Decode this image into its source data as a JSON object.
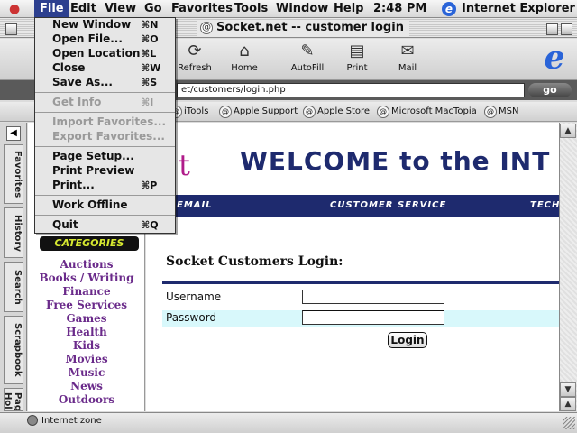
{
  "menubar": {
    "items": [
      "File",
      "Edit",
      "View",
      "Go",
      "Favorites",
      "Tools",
      "Window",
      "Help"
    ],
    "clock": "2:48 PM",
    "app_name": "Internet Explorer"
  },
  "window": {
    "title": "Socket.net -- customer login"
  },
  "toolbar": {
    "buttons": [
      "Refresh",
      "Home",
      "AutoFill",
      "Print",
      "Mail"
    ]
  },
  "address": {
    "value": "et/customers/login.php",
    "go_label": "go"
  },
  "favorites_bar": {
    "links": [
      "iTools",
      "Apple Support",
      "Apple Store",
      "Microsoft MacTopia",
      "MSN"
    ]
  },
  "explorer_tabs": [
    "Favorites",
    "History",
    "Search",
    "Scrapbook",
    "Page Holder"
  ],
  "site": {
    "banner": "WELCOME to the INT",
    "banner_logo_fragment": "t",
    "nav": [
      "EMAIL",
      "CUSTOMER SERVICE",
      "TECH"
    ],
    "categories_logo": "CATEGORIES",
    "categories": [
      "Auctions",
      "Books / Writing",
      "Finance",
      "Free Services",
      "Games",
      "Health",
      "Kids",
      "Movies",
      "Music",
      "News",
      "Outdoors"
    ],
    "login_heading": "Socket Customers Login:",
    "username_label": "Username",
    "password_label": "Password",
    "login_button": "Login"
  },
  "status": {
    "text": "Internet zone"
  },
  "file_menu": {
    "items": [
      {
        "label": "New Window",
        "shortcut": "⌘N",
        "enabled": true
      },
      {
        "label": "Open File...",
        "shortcut": "⌘O",
        "enabled": true
      },
      {
        "label": "Open Location",
        "shortcut": "⌘L",
        "enabled": true
      },
      {
        "label": "Close",
        "shortcut": "⌘W",
        "enabled": true
      },
      {
        "label": "Save As...",
        "shortcut": "⌘S",
        "enabled": true
      },
      {
        "label": "Get Info",
        "shortcut": "⌘I",
        "enabled": false
      },
      {
        "label": "Import Favorites...",
        "shortcut": "",
        "enabled": false
      },
      {
        "label": "Export Favorites...",
        "shortcut": "",
        "enabled": false
      },
      {
        "label": "Page Setup...",
        "shortcut": "",
        "enabled": true
      },
      {
        "label": "Print Preview",
        "shortcut": "",
        "enabled": true
      },
      {
        "label": "Print...",
        "shortcut": "⌘P",
        "enabled": true
      },
      {
        "label": "Work Offline",
        "shortcut": "",
        "enabled": true
      },
      {
        "label": "Quit",
        "shortcut": "⌘Q",
        "enabled": true
      }
    ]
  },
  "colors": {
    "menu_highlight": "#2c3f8f",
    "site_navy": "#1e2a6e",
    "category_link": "#6a2a8a",
    "password_row": "#d8f8fb"
  }
}
